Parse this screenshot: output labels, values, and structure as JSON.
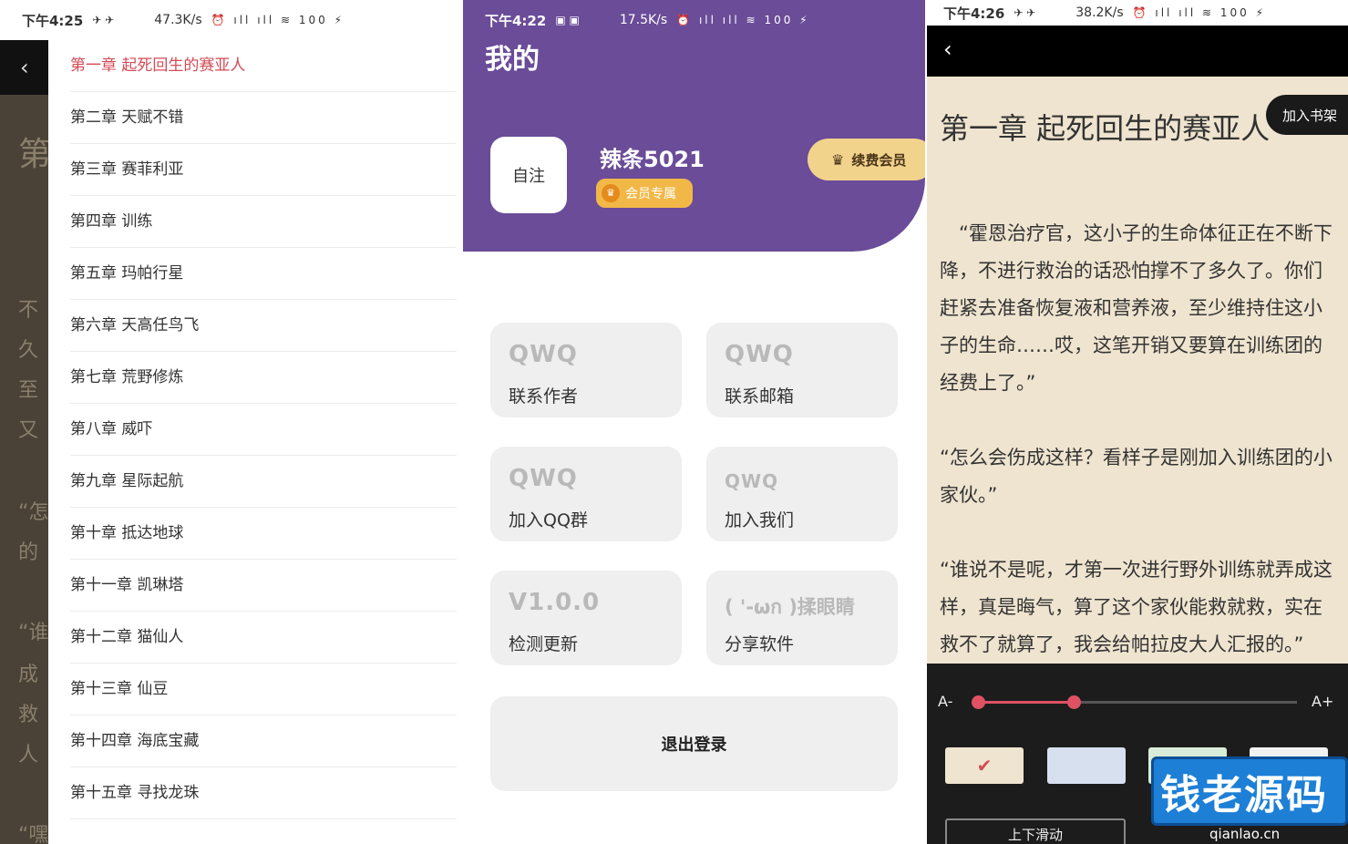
{
  "panel1": {
    "status": {
      "time": "下午4:25",
      "speed": "47.3K/s",
      "icons": "⏰ ıll ıll ≋ 100 ⚡"
    },
    "peek_lines": [
      "第",
      "不",
      "久",
      "至",
      "又",
      "“怎",
      "的",
      "“谁",
      "成",
      "救",
      "人",
      "“嘿"
    ],
    "chapters": [
      "第一章 起死回生的赛亚人",
      "第二章 天赋不错",
      "第三章 赛菲利亚",
      "第四章 训练",
      "第五章 玛帕行星",
      "第六章 天高任鸟飞",
      "第七章 荒野修炼",
      "第八章 威吓",
      "第九章 星际起航",
      "第十章 抵达地球",
      "第十一章 凯琳塔",
      "第十二章 猫仙人",
      "第十三章 仙豆",
      "第十四章 海底宝藏",
      "第十五章 寻找龙珠"
    ]
  },
  "panel2": {
    "status": {
      "time": "下午4:22",
      "speed": "17.5K/s",
      "icons": "⏰ ıll ıll ≋ 100 ⚡"
    },
    "title": "我的",
    "avatar_text": "自注",
    "username": "辣条5021",
    "vip_badge": "会员专属",
    "renew_label": "续费会员",
    "cards": [
      {
        "big": "QWQ",
        "label": "联系作者"
      },
      {
        "big": "QWQ",
        "label": "联系邮箱"
      },
      {
        "big": "QWQ",
        "label": "加入QQ群"
      },
      {
        "big": "QWQ",
        "label": "加入我们"
      },
      {
        "big": "V1.0.0",
        "label": "检测更新"
      },
      {
        "big": "( '-ωก )揉眼睛",
        "label": "分享软件"
      }
    ],
    "logout_label": "退出登录"
  },
  "panel3": {
    "status": {
      "time": "下午4:26",
      "speed": "38.2K/s",
      "icons": "⏰ ıll ıll ≋ 100 ⚡"
    },
    "chapter_title": "第一章 起死回生的赛亚人",
    "add_shelf": "加入书架",
    "paragraphs": [
      "　“霍恩治疗官，这小子的生命体征正在不断下降，不进行救治的话恐怕撑不了多久了。你们赶紧去准备恢复液和营养液，至少维持住这小子的生命……哎，这笔开销又要算在训练团的经费上了。”",
      "“怎么会伤成这样？看样子是刚加入训练团的小家伙。”",
      "“谁说不是呢，才第一次进行野外训练就弄成这样，真是晦气，算了这个家伙能救就救，实在救不了就算了，我会给帕拉皮大人汇报的。”"
    ],
    "font_minus": "A-",
    "font_plus": "A+",
    "font_size_level": 0.3,
    "swatch_colors": [
      "#efe4cf",
      "#d6e0ee",
      "#d9ecd9",
      "#f2f2f2"
    ],
    "scroll_mode": "上下滑动",
    "watermark": {
      "text": "钱老源码",
      "url": "qianlao.cn"
    }
  }
}
